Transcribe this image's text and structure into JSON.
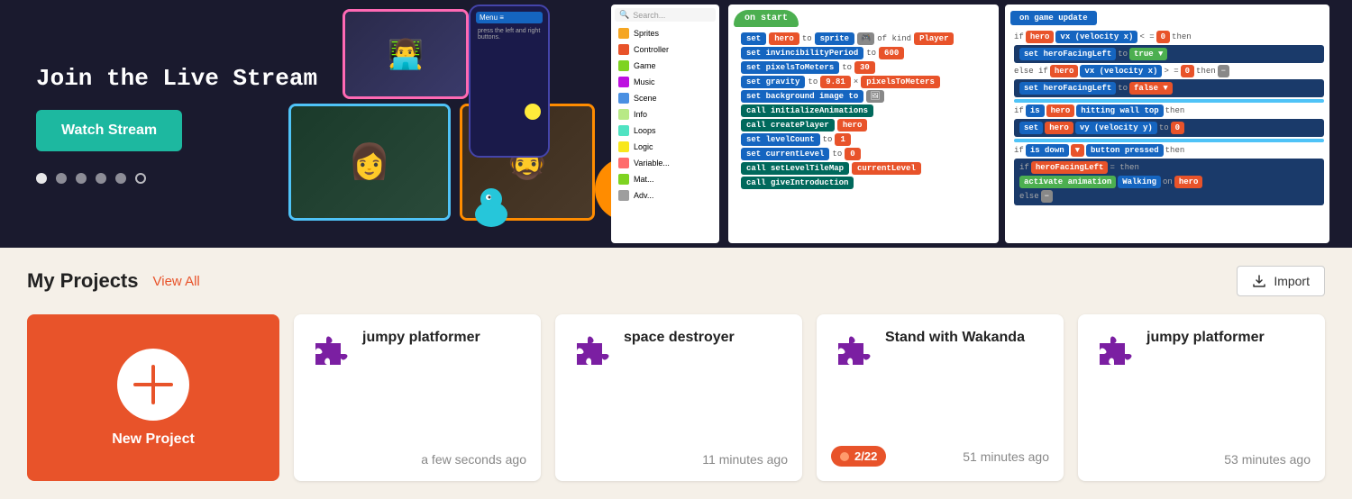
{
  "hero": {
    "title": "Join the Live Stream",
    "watch_btn": "Watch Stream",
    "dots": [
      {
        "active": true
      },
      {
        "active": false
      },
      {
        "active": false
      },
      {
        "active": false
      },
      {
        "active": false
      },
      {
        "outline": true
      }
    ]
  },
  "menu": {
    "search_placeholder": "Search...",
    "items": [
      {
        "label": "Sprites",
        "color": "#f5a623"
      },
      {
        "label": "Controller",
        "color": "#e8532a"
      },
      {
        "label": "Game",
        "color": "#7ed321"
      },
      {
        "label": "Music",
        "color": "#bd10e0"
      },
      {
        "label": "Scene",
        "color": "#4a90e2"
      },
      {
        "label": "Info",
        "color": "#b8e986"
      },
      {
        "label": "Loops",
        "color": "#50e3c2"
      },
      {
        "label": "Logic",
        "color": "#f8e71c"
      },
      {
        "label": "Variables",
        "color": "#ff6b6b"
      },
      {
        "label": "Math",
        "color": "#7ed321"
      }
    ]
  },
  "projects": {
    "title": "My Projects",
    "view_all": "View All",
    "import_btn": "Import",
    "new_project": "New Project",
    "cards": [
      {
        "name": "jumpy platformer",
        "time": "a few seconds ago",
        "has_progress": false
      },
      {
        "name": "space destroyer",
        "time": "11 minutes ago",
        "has_progress": false
      },
      {
        "name": "Stand with Wakanda",
        "time": "51 minutes ago",
        "has_progress": true,
        "progress": "2/22"
      },
      {
        "name": "jumpy platformer",
        "time": "53 minutes ago",
        "has_progress": false
      }
    ]
  }
}
